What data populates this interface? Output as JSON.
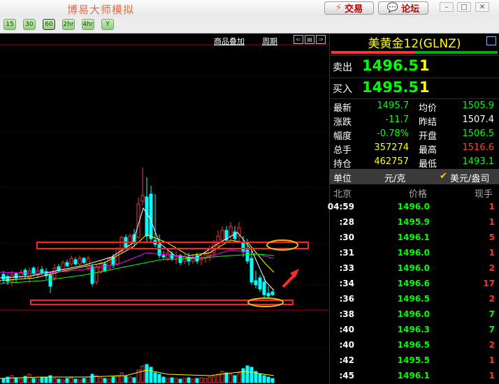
{
  "app": {
    "title": "博易大师模拟",
    "trade_label": "交易",
    "forum_label": "论坛"
  },
  "periods": [
    "15",
    "30",
    "60",
    "2hr",
    "4hr",
    "Y"
  ],
  "chart": {
    "overlay_label": "商品叠加",
    "cycle_label": "周期"
  },
  "quote": {
    "symbol": "美黄金12(GLNZ)",
    "sell_label": "卖出",
    "sell_price": "1496.5",
    "sell_qty": "1",
    "buy_label": "买入",
    "buy_price": "1495.5",
    "buy_qty": "1",
    "stats": [
      {
        "l1": "最新",
        "v1": "1495.7",
        "l2": "均价",
        "v2": "1505.9"
      },
      {
        "l1": "涨跌",
        "v1": "-11.7",
        "l2": "昨结",
        "v2": "1507.4"
      },
      {
        "l1": "幅度",
        "v1": "-0.78%",
        "l2": "开盘",
        "v2": "1506.5"
      },
      {
        "l1": "总手",
        "v1": "357274",
        "l2": "最高",
        "v2": "1516.6"
      },
      {
        "l1": "持仓",
        "v1": "462757",
        "l2": "最低",
        "v2": "1493.1"
      }
    ],
    "unit_label": "单位",
    "unit_value": "元/克",
    "unit_check": "✔",
    "unit_alt": "美元/盎司",
    "ticks_header": {
      "time": "北京",
      "price": "价格",
      "qty": "现手"
    },
    "ticks": [
      {
        "time": "04:59",
        "price": "1496.0",
        "qty": "1"
      },
      {
        "time": ":28",
        "price": "1495.9",
        "qty": "1"
      },
      {
        "time": ":30",
        "price": "1496.1",
        "qty": "5"
      },
      {
        "time": ":31",
        "price": "1496.0",
        "qty": "1"
      },
      {
        "time": ":33",
        "price": "1496.0",
        "qty": "2"
      },
      {
        "time": ":34",
        "price": "1496.6",
        "qty": "17"
      },
      {
        "time": ":36",
        "price": "1496.5",
        "qty": "2"
      },
      {
        "time": ":38",
        "price": "1496.0",
        "qty": "7"
      },
      {
        "time": ":40",
        "price": "1496.3",
        "qty": "7"
      },
      {
        "time": ":40",
        "price": "1496.5",
        "qty": "2"
      },
      {
        "time": ":42",
        "price": "1495.5",
        "qty": "1"
      },
      {
        "time": ":45",
        "price": "1496.1",
        "qty": "1"
      }
    ]
  },
  "colors": {
    "up": "#ff3030",
    "down": "#00ffff",
    "green": "#00ff00",
    "yellow": "#ffff00"
  }
}
